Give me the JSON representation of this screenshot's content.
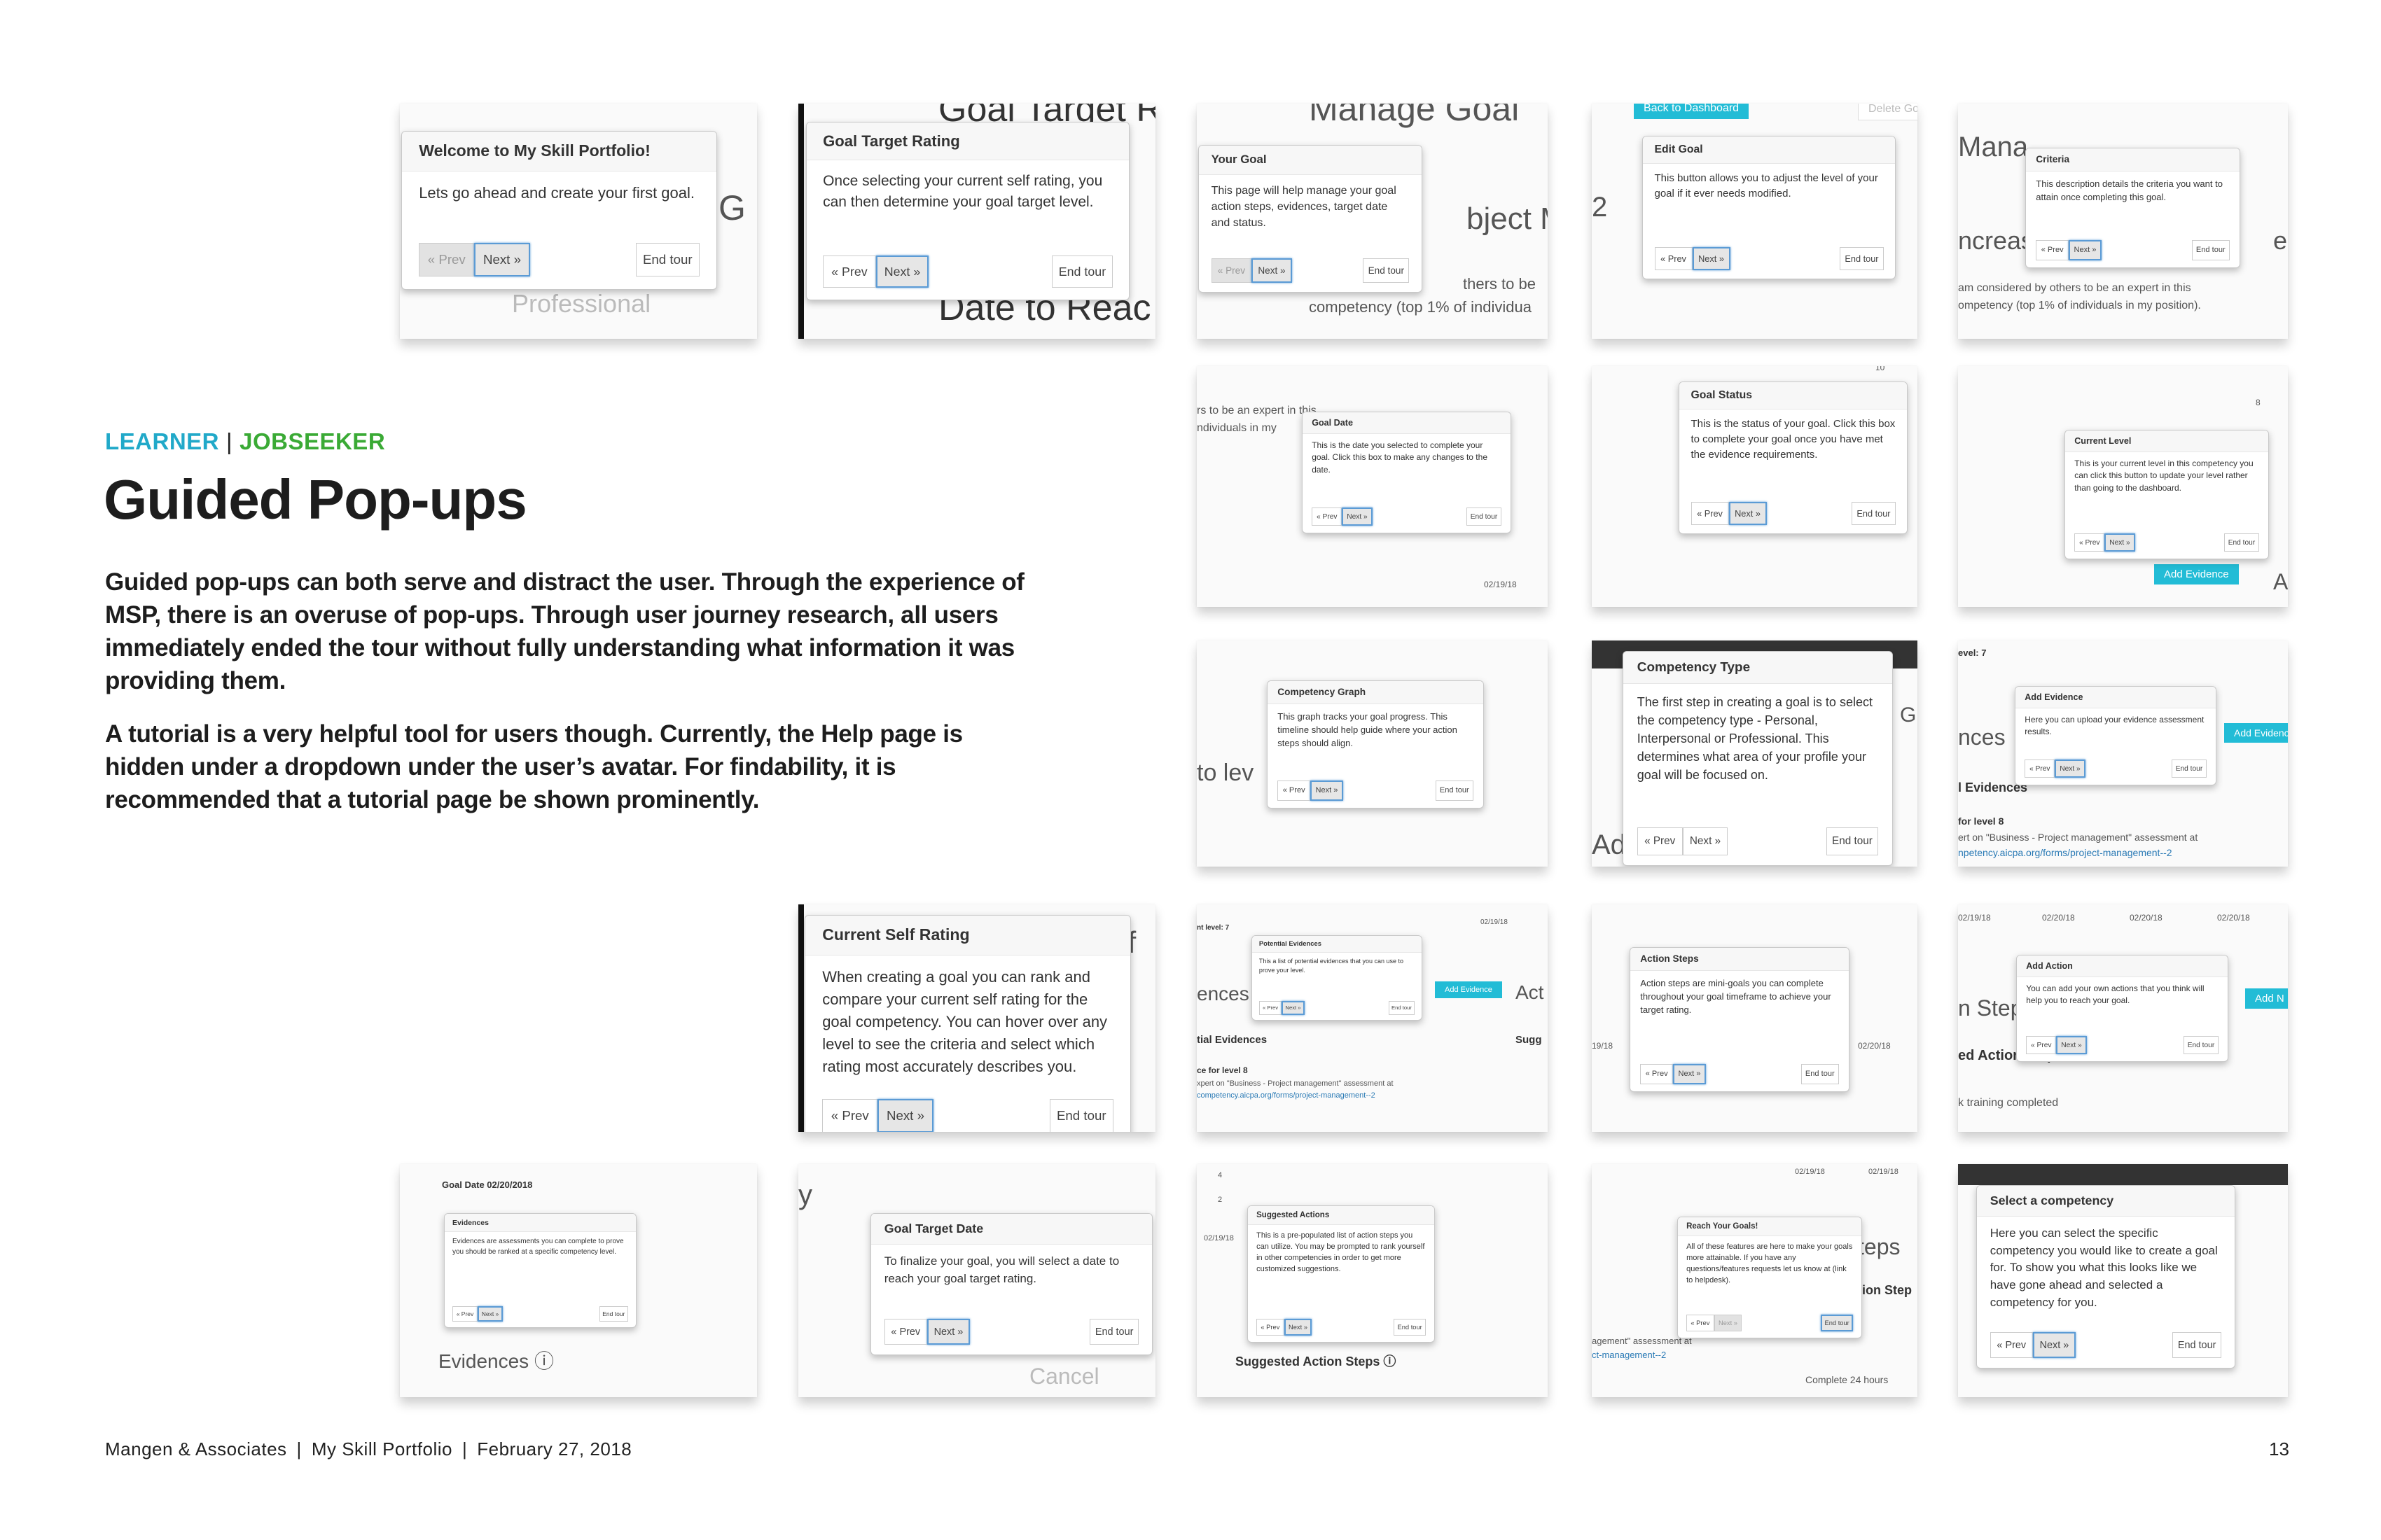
{
  "header": {
    "tag_learner": "LEARNER",
    "tag_separator": "|",
    "tag_jobseeker": "JOBSEEKER",
    "title": "Guided Pop-ups"
  },
  "paragraphs": [
    "Guided pop-ups can both serve and distract the user. Through the experience of MSP, there is an overuse of pop-ups. Through user journey research, all users immediately ended the tour without fully understanding what information it was providing them.",
    "A tutorial is a very helpful tool for users though. Currently, the Help page is hidden under a dropdown under the user’s avatar. For findability, it is recommended that a tutorial page be shown prominently."
  ],
  "footer": {
    "company": "Mangen & Associates",
    "product": "My Skill Portfolio",
    "date": "February 27, 2018",
    "separator": "|",
    "page_number": "13"
  },
  "tour_buttons": {
    "prev": "« Prev",
    "next": "Next »",
    "end": "End tour"
  },
  "colors": {
    "learner": "#21a9c9",
    "jobseeker": "#3aaa35",
    "accent_teal": "#22bcd6",
    "focus_blue": "#5b9bd5"
  },
  "cards": [
    {
      "title": "Welcome to My Skill Portfolio!",
      "body": "Lets go ahead and create your first goal.",
      "state": "first",
      "bg": [
        "Professional",
        "G"
      ]
    },
    {
      "title": "Goal Target Rating",
      "body": "Once selecting your current self rating, you can then determine your goal target level.",
      "state": "normal",
      "bg": [
        "Goal Target R",
        "Date to Reac"
      ]
    },
    {
      "title": "Your Goal",
      "body": "This page will help manage your goal action steps, evidences, target date and status.",
      "state": "first",
      "bg": [
        "Manage Goal",
        "bject M",
        "thers to be",
        "competency (top 1% of individua"
      ]
    },
    {
      "title": "Edit Goal",
      "body": "This button allows you to adjust the level of your goal if it ever needs modified.",
      "state": "normal",
      "bg": [
        "2"
      ],
      "teal": [
        "Back to Dashboard"
      ],
      "outline": [
        "Delete Goal"
      ]
    },
    {
      "title": "Criteria",
      "body": "This description details the criteria you want to attain once completing this goal.",
      "state": "normal",
      "bg": [
        "Mana",
        "ncreas",
        "ent",
        "am considered by others to be an expert in this",
        "ompetency (top 1% of individuals in my position)."
      ]
    },
    {
      "title": "Goal Date",
      "body": "This is the date you selected to complete your goal. Click this box to make any changes to the date.",
      "state": "normal",
      "bg": [
        "rs to be an expert in this",
        "ndividuals in my",
        "02/19/18"
      ]
    },
    {
      "title": "Goal Status",
      "body": "This is the status of your goal. Click this box to complete your goal once you have met the evidence requirements.",
      "state": "normal",
      "bg": [
        "10"
      ]
    },
    {
      "title": "Current Level",
      "body": "This is your current level in this competency you can click this button to update your level rather than going to the dashboard.",
      "state": "normal",
      "bg": [
        "Ac",
        "8",
        "6"
      ],
      "teal": [
        "Add Evidence"
      ]
    },
    {
      "title": "Competency Graph",
      "body": "This graph tracks your goal progress. This timeline should help guide where your action steps should align.",
      "state": "normal",
      "bg": [
        "to lev"
      ]
    },
    {
      "title": "Competency Type",
      "body": "The first step in creating a goal is to select the competency type - Personal, Interpersonal or Professional. This determines what area of your profile your goal will be focused on.",
      "state": "plain",
      "bg": [
        "Gl",
        "Ad"
      ],
      "dark_bar": true
    },
    {
      "title": "Add Evidence",
      "body": "Here you can upload your evidence assessment results.",
      "state": "normal",
      "bg": [
        "evel: 7",
        "nces",
        "l Evidences",
        "for level 8",
        "ert on \"Business - Project management\" assessment at",
        "npetency.aicpa.org/forms/project-management--2"
      ],
      "teal": [
        "Add Evidence"
      ]
    },
    {
      "title": "Current Self Rating",
      "body": "When creating a goal you can rank and compare your current self rating for the goal competency. You can hover over any level to see the criteria and select which rating most accurately describes you.",
      "state": "normal",
      "bg": [
        "f"
      ],
      "black_bar": true
    },
    {
      "title": "Potential Evidences",
      "body": "This a list of potential evidences that you can use to prove your level.",
      "state": "normal",
      "bg": [
        "nt level: 7",
        "ences",
        "Act",
        "tial Evidences",
        "ce for level 8",
        "xpert on \"Business - Project management\" assessment at",
        "competency.aicpa.org/forms/project-management--2",
        "02/19/18",
        "Sugg"
      ],
      "teal": [
        "Add Evidence"
      ]
    },
    {
      "title": "Action Steps",
      "body": "Action steps are mini-goals you can complete throughout your goal timeframe to achieve your target rating.",
      "state": "normal",
      "bg": [
        "19/18",
        "02/20/18"
      ]
    },
    {
      "title": "Add Action",
      "body": "You can add your own actions that you think will help you to reach your goal.",
      "state": "normal",
      "bg": [
        "02/19/18",
        "02/20/18",
        "02/20/18",
        "02/20/18",
        "n Step",
        "ed Action Steps",
        "k training completed"
      ],
      "teal": [
        "Add N"
      ]
    },
    {
      "title": "Evidences",
      "body": "Evidences are assessments you can complete to prove you should be ranked at a specific competency level.",
      "state": "normal",
      "bg": [
        "Goal Date 02/20/2018",
        "Evidences ⓘ"
      ]
    },
    {
      "title": "Goal Target Date",
      "body": "To finalize your goal, you will select a date to reach your goal target rating.",
      "state": "normal",
      "bg": [
        "y",
        "Cancel"
      ]
    },
    {
      "title": "Suggested Actions",
      "body": "This is a pre-populated list of action steps you can utilize. You may be prompted to rank yourself in other competencies in order to get more customized suggestions.",
      "state": "normal",
      "bg": [
        "Suggested Action Steps ⓘ",
        "02/19/18",
        "02/20/18",
        "4",
        "2"
      ]
    },
    {
      "title": "Reach Your Goals!",
      "body": "All of these features are here to make your goals more attainable. If you have any questions/features requests let us know at (link to helpdesk).",
      "state": "last",
      "bg": [
        "02/19/18",
        "02/19/18",
        "teps",
        "tion Step",
        "agement\" assessment at",
        "ct-management--2",
        "Complete 24 hours"
      ]
    },
    {
      "title": "Select a competency",
      "body": "Here you can select the specific competency you would like to create a goal for. To show you what this looks like we have gone ahead and selected a competency for you.",
      "state": "normal",
      "bg": [],
      "dark_bar": true
    }
  ]
}
